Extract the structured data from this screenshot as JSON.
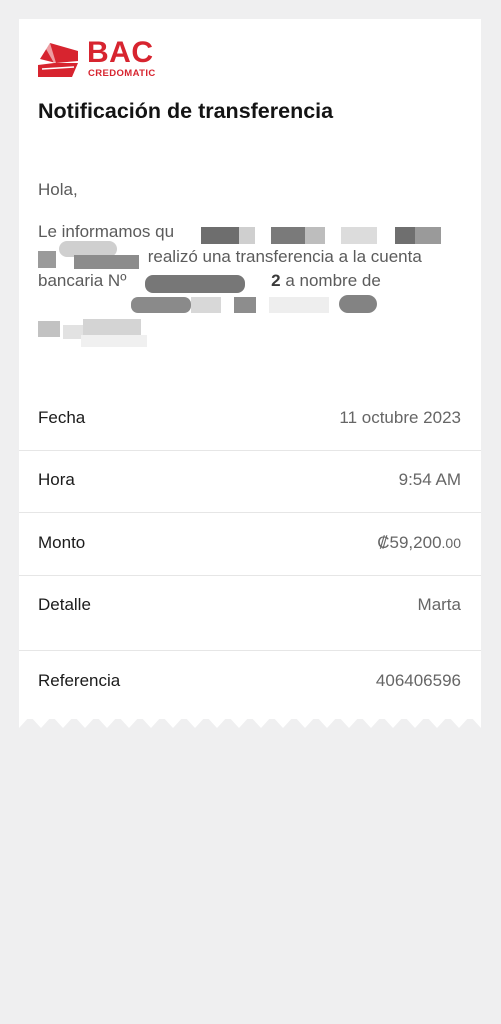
{
  "brand": {
    "name": "BAC",
    "sub": "CREDOMATIC",
    "color": "#d7242f"
  },
  "title": "Notificación de transferencia",
  "greeting": "Hola,",
  "message": {
    "part1": "Le informamos qu",
    "part2": " realizó una transferencia a la cuenta bancaria Nº ",
    "part3": "2",
    "part4": " a nombre de"
  },
  "details": [
    {
      "label": "Fecha",
      "value": "11 octubre 2023"
    },
    {
      "label": "Hora",
      "value": "9:54 AM"
    },
    {
      "label": "Monto",
      "value": "₡59,200",
      "cents": ".00"
    },
    {
      "label": "Detalle",
      "value": "Marta"
    },
    {
      "label": "Referencia",
      "value": "406406596"
    }
  ]
}
